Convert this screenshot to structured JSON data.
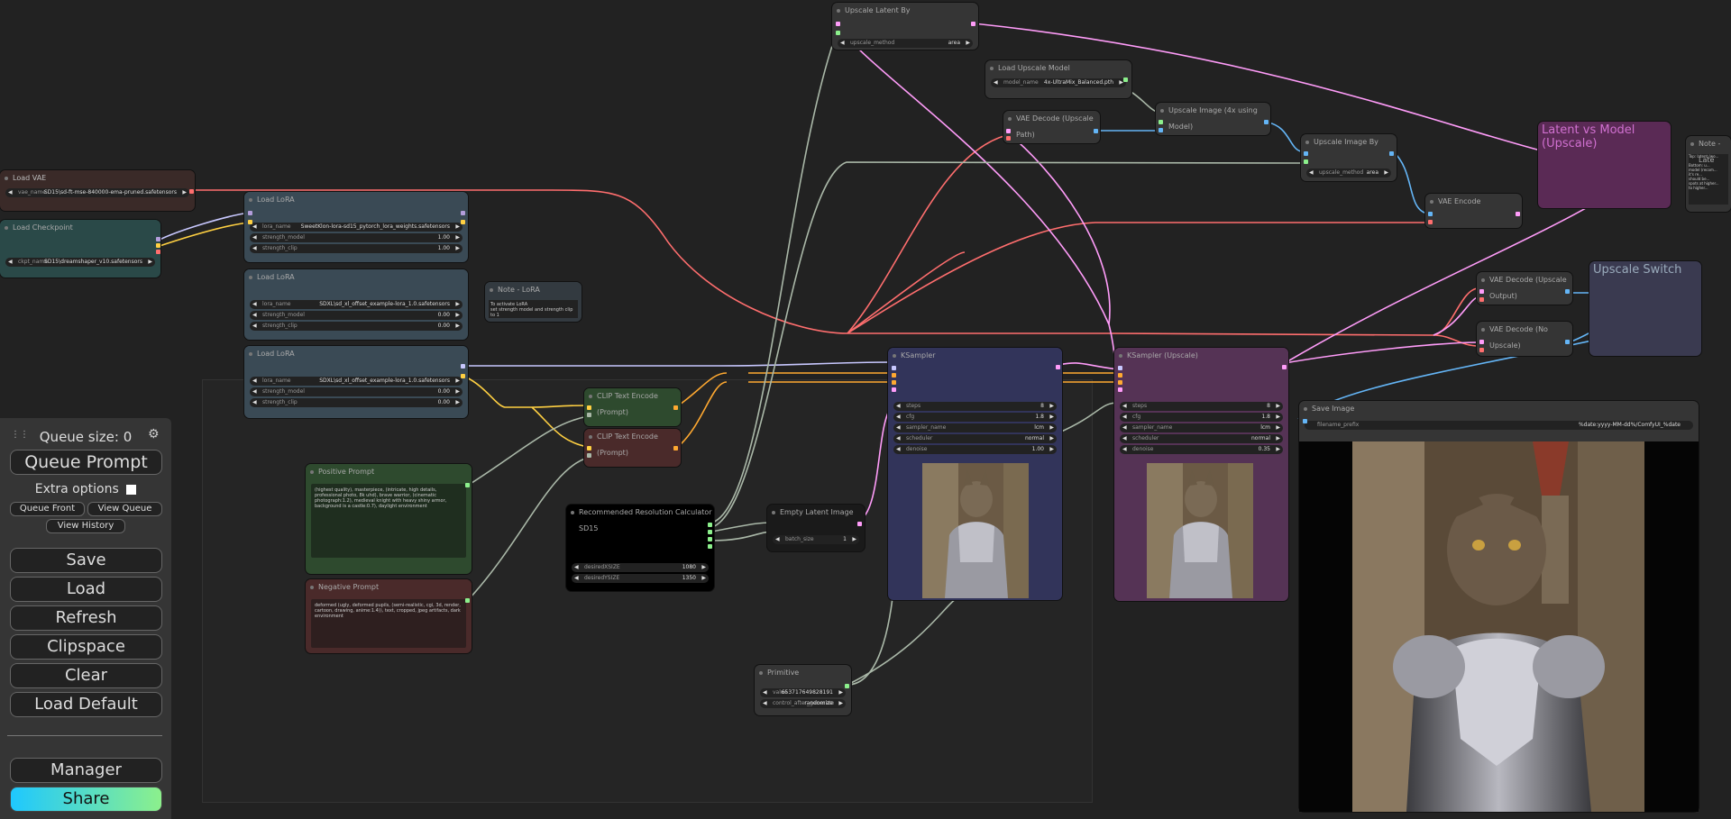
{
  "panel": {
    "queue_size": "Queue size: 0",
    "queue_prompt": "Queue Prompt",
    "extra_options": "Extra options",
    "queue_front": "Queue Front",
    "view_queue": "View Queue",
    "view_history": "View History",
    "save": "Save",
    "load": "Load",
    "refresh": "Refresh",
    "clipspace": "Clipspace",
    "clear": "Clear",
    "load_default": "Load Default",
    "manager": "Manager",
    "share": "Share"
  },
  "nodes": {
    "load_vae": {
      "title": "Load VAE",
      "w_label": "vae_name",
      "w_value": "SD15\\sd-ft-mse-840000-ema-pruned.safetensors"
    },
    "load_checkpoint": {
      "title": "Load Checkpoint",
      "w_label": "ckpt_name",
      "w_value": "SD15\\dreamshaper_v10.safetensors"
    },
    "lora1": {
      "title": "Load LoRA",
      "lora_name": "lora_name",
      "lora_value": "SweetKlon-lora-sd15_pytorch_lora_weights.safetensors",
      "sm_label": "strength_model",
      "sm_value": "1.00",
      "sc_label": "strength_clip",
      "sc_value": "1.00"
    },
    "lora2": {
      "title": "Load LoRA",
      "lora_name": "lora_name",
      "lora_value": "SDXL\\sd_xl_offset_example-lora_1.0.safetensors",
      "sm_label": "strength_model",
      "sm_value": "0.00",
      "sc_label": "strength_clip",
      "sc_value": "0.00"
    },
    "lora3": {
      "title": "Load LoRA",
      "lora_name": "lora_name",
      "lora_value": "SDXL\\sd_xl_offset_example-lora_1.0.safetensors",
      "sm_label": "strength_model",
      "sm_value": "0.00",
      "sc_label": "strength_clip",
      "sc_value": "0.00"
    },
    "note_lora": {
      "title": "Note - LoRA",
      "text": "To activate LoRA\nset strength model and strength clip\nto 1"
    },
    "clip_pos": {
      "title": "CLIP Text Encode (Prompt)"
    },
    "clip_neg": {
      "title": "CLIP Text Encode (Prompt)"
    },
    "positive": {
      "title": "Positive Prompt",
      "text": "(highest quality), masterpiece, (intricate, high details, professional photo, 8k uhd), brave warrior, (cinematic photograph:1.2), medieval knight with heavy shiny armor, background is a castle:0.7), daylight environment"
    },
    "negative": {
      "title": "Negative Prompt",
      "text": "deformed (ugly, deformed pupils, (semi-realistic, cgi, 3d, render, cartoon, drawing, anime:1.4)), text, cropped, jpeg artifacts, dark environment"
    },
    "res_calc": {
      "title": "Recommended Resolution Calculator SD15",
      "w1_label": "desiredXSIZE",
      "w1_value": "1080",
      "w2_label": "desiredYSIZE",
      "w2_value": "1350"
    },
    "empty_latent": {
      "title": "Empty Latent Image",
      "w_label": "batch_size",
      "w_value": "1"
    },
    "primitive": {
      "title": "Primitive",
      "w1_label": "value",
      "w1_value": "653717649828191",
      "w2_label": "control_after_generate",
      "w2_value": "randomize"
    },
    "upscale_latent": {
      "title": "Upscale Latent By",
      "w_label": "upscale_method",
      "w_value": "area"
    },
    "load_upscale": {
      "title": "Load Upscale Model",
      "w_label": "model_name",
      "w_value": "4x-UltraMix_Balanced.pth"
    },
    "vae_decode_up": {
      "title": "VAE Decode (Upscale Path)"
    },
    "upscale_image_model": {
      "title": "Upscale Image (4x using Model)"
    },
    "upscale_image_by": {
      "title": "Upscale Image By",
      "w_label": "upscale_method",
      "w_value": "area"
    },
    "vae_encode": {
      "title": "VAE Encode"
    },
    "latent_vs_model": {
      "title": "Latent vs Model (Upscale)"
    },
    "note_latent": {
      "title": "Note - Late",
      "text": "Top: latent (wo...\n\nBottom: u...\nmodel (recom...\nit's re...\nshould be...\nspots at higher...\nto higher..."
    },
    "vae_decode_out": {
      "title": "VAE Decode (Upscale Output)"
    },
    "vae_decode_noup": {
      "title": "VAE Decode (No Upscale)"
    },
    "upscale_switch": {
      "title": "Upscale Switch"
    },
    "ksampler": {
      "title": "KSampler",
      "widgets": [
        {
          "label": "steps",
          "value": "8"
        },
        {
          "label": "cfg",
          "value": "1.8"
        },
        {
          "label": "sampler_name",
          "value": "lcm"
        },
        {
          "label": "scheduler",
          "value": "normal"
        },
        {
          "label": "denoise",
          "value": "1.00"
        }
      ]
    },
    "ksampler_up": {
      "title": "KSampler (Upscale)",
      "widgets": [
        {
          "label": "steps",
          "value": "8"
        },
        {
          "label": "cfg",
          "value": "1.8"
        },
        {
          "label": "sampler_name",
          "value": "lcm"
        },
        {
          "label": "scheduler",
          "value": "normal"
        },
        {
          "label": "denoise",
          "value": "0.35"
        }
      ]
    },
    "save_image": {
      "title": "Save Image",
      "w_label": "filename_prefix",
      "w_value": "%date:yyyy-MM-dd%/ComfyUI_%date"
    }
  },
  "colors": {
    "clip_wire": "#c8c8ff",
    "model_wire": "#b39ddb",
    "conditioning_wire": "#ffa931",
    "latent_wire": "#ff9cf9",
    "vae_wire": "#ff6e6e",
    "image_wire": "#64b5f6",
    "int_wire": "#aab8a8",
    "share_gradient_start": "#1ec8ff",
    "share_gradient_end": "#8cf08c"
  }
}
